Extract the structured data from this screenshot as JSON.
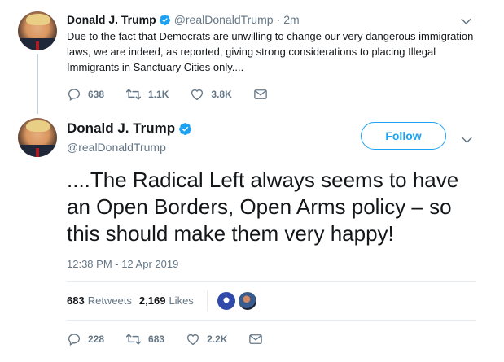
{
  "tweet1": {
    "name": "Donald J. Trump",
    "handle": "@realDonaldTrump",
    "separator": "·",
    "time": "2m",
    "text": "Due to the fact that Democrats are unwilling to change our very dangerous immigration laws, we are indeed, as reported, giving strong considerations to placing Illegal Immigrants in Sanctuary Cities only....",
    "replies": "638",
    "retweets": "1.1K",
    "likes": "3.8K"
  },
  "tweet2": {
    "name": "Donald J. Trump",
    "handle": "@realDonaldTrump",
    "follow_label": "Follow",
    "text": "....The Radical Left always seems to have an Open Borders, Open Arms policy – so this should make them very happy!",
    "timestamp": "12:38 PM - 12 Apr 2019",
    "retweet_count": "683",
    "retweet_label": "Retweets",
    "like_count": "2,169",
    "like_label": "Likes",
    "replies": "228",
    "retweets": "683",
    "likes": "2.2K"
  },
  "colors": {
    "accent": "#1da1f2",
    "muted": "#657786",
    "text": "#14171a",
    "divider": "#e6ecf0"
  },
  "icons": [
    "verified-badge-icon",
    "chevron-down-icon",
    "reply-icon",
    "retweet-icon",
    "like-icon",
    "direct-message-icon"
  ]
}
